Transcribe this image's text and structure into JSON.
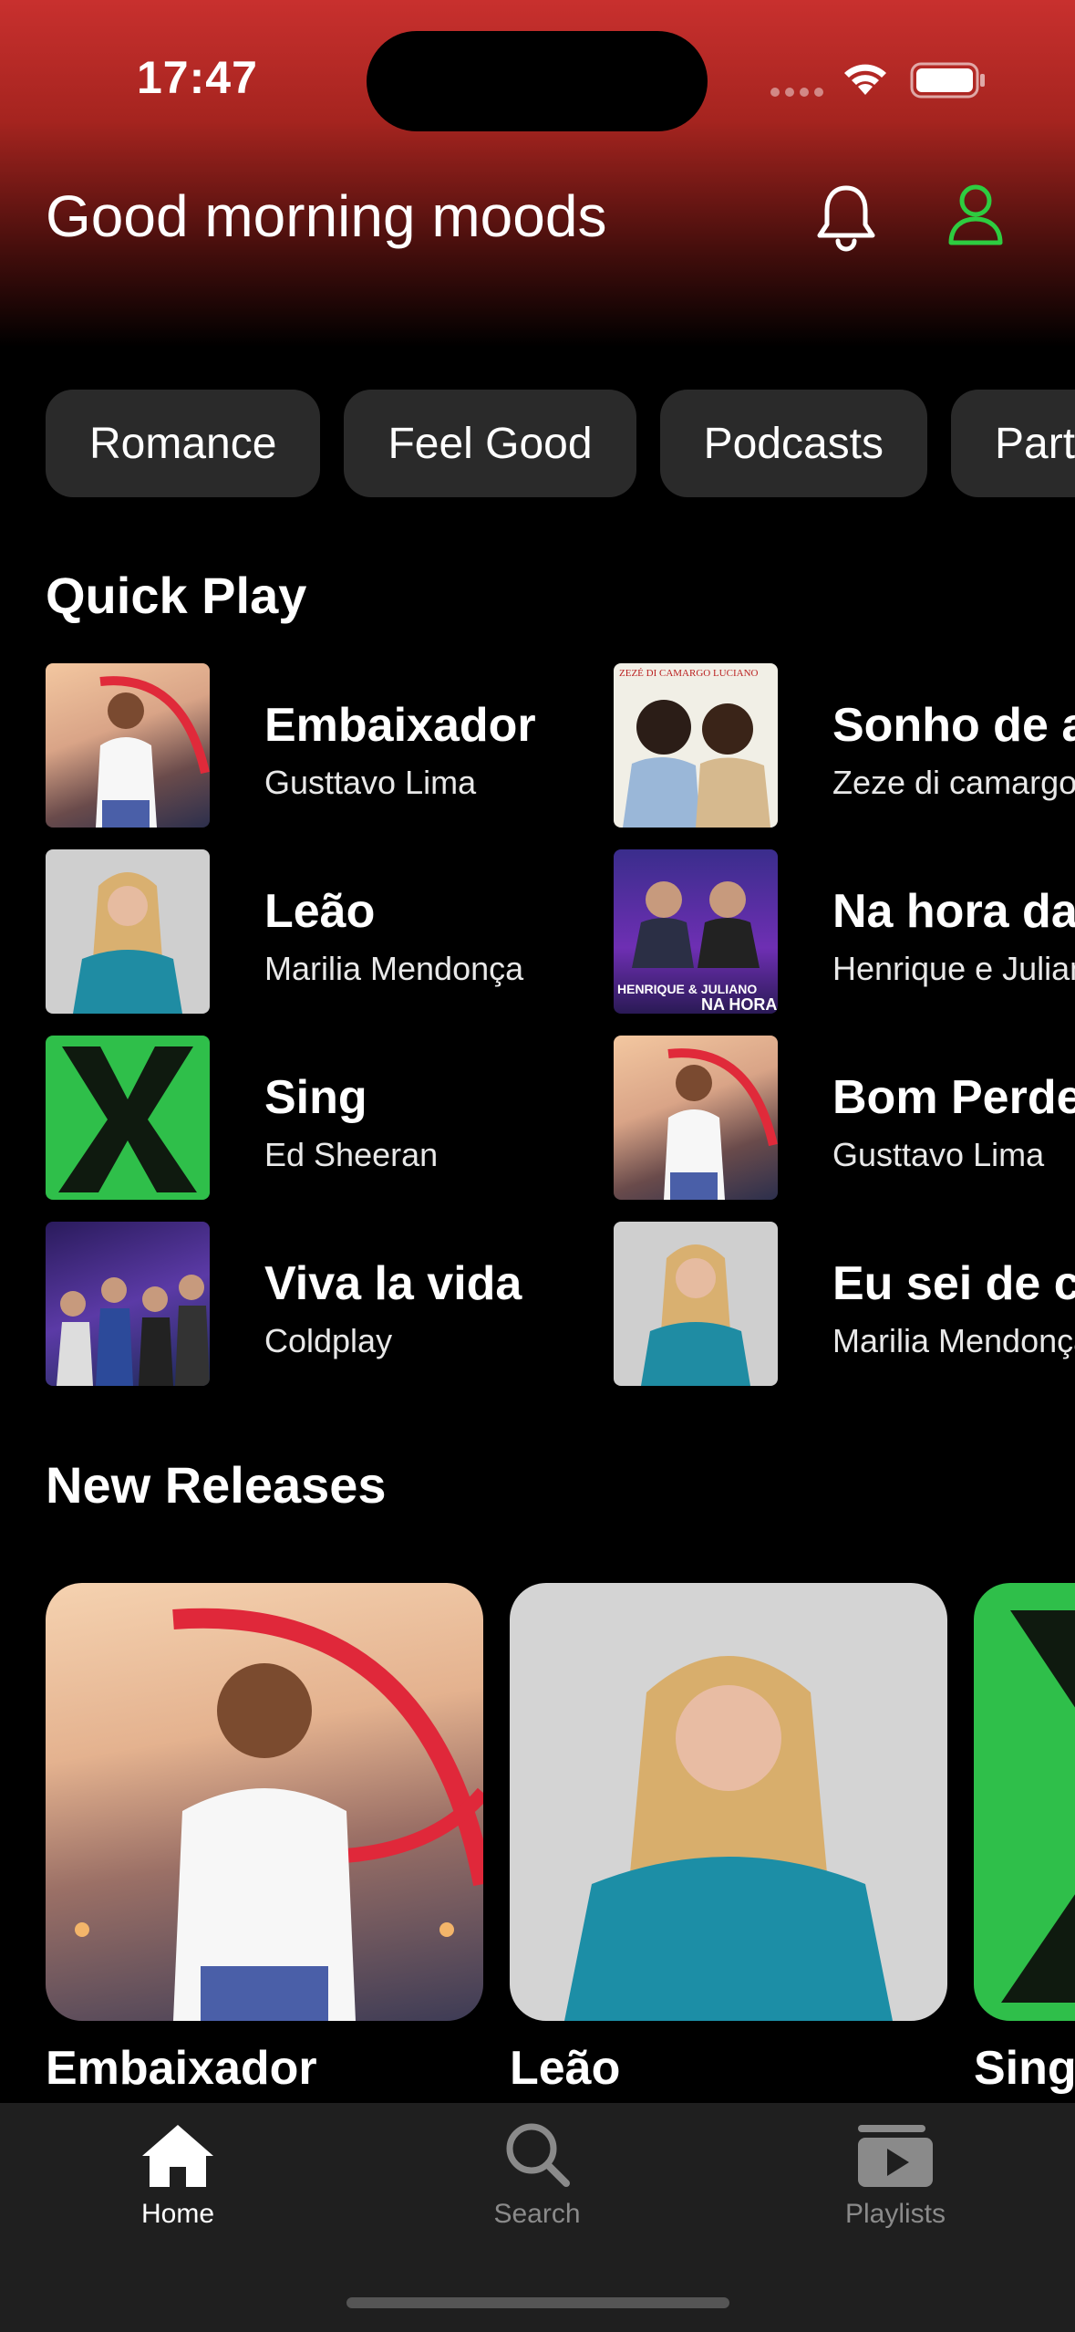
{
  "status_bar": {
    "time": "17:47"
  },
  "header": {
    "greeting": "Good morning moods"
  },
  "chips": [
    "Romance",
    "Feel Good",
    "Podcasts",
    "Party"
  ],
  "quick_play": {
    "title": "Quick Play",
    "items": [
      {
        "title": "Embaixador",
        "artist": "Gusttavo Lima"
      },
      {
        "title": "Sonho de amor",
        "artist": "Zeze di camargo"
      },
      {
        "title": "Leão",
        "artist": "Marilia Mendonça"
      },
      {
        "title": "Na hora da raiva",
        "artist": "Henrique e Juliano"
      },
      {
        "title": "Sing",
        "artist": "Ed Sheeran"
      },
      {
        "title": "Bom Perdedor",
        "artist": "Gusttavo Lima"
      },
      {
        "title": "Viva la vida",
        "artist": "Coldplay"
      },
      {
        "title": "Eu sei de cor",
        "artist": "Marilia Mendonça"
      }
    ]
  },
  "new_releases": {
    "title": "New Releases",
    "items": [
      {
        "title": "Embaixador"
      },
      {
        "title": "Leão"
      },
      {
        "title": "Sing"
      }
    ]
  },
  "art_text": {
    "na_hora": "NA HORA da RAIVA",
    "henrique": "HENRIQUE & JULIANO",
    "zeze": "ZEZÉ DI CAMARGO LUCIANO"
  },
  "tabs": [
    {
      "label": "Home",
      "icon": "home-icon",
      "active": true
    },
    {
      "label": "Search",
      "icon": "search-icon",
      "active": false
    },
    {
      "label": "Playlists",
      "icon": "playlists-icon",
      "active": false
    }
  ],
  "colors": {
    "accent_green": "#2ecc40",
    "header_red": "#c8302e",
    "inactive_tab": "#8a8a8a"
  }
}
